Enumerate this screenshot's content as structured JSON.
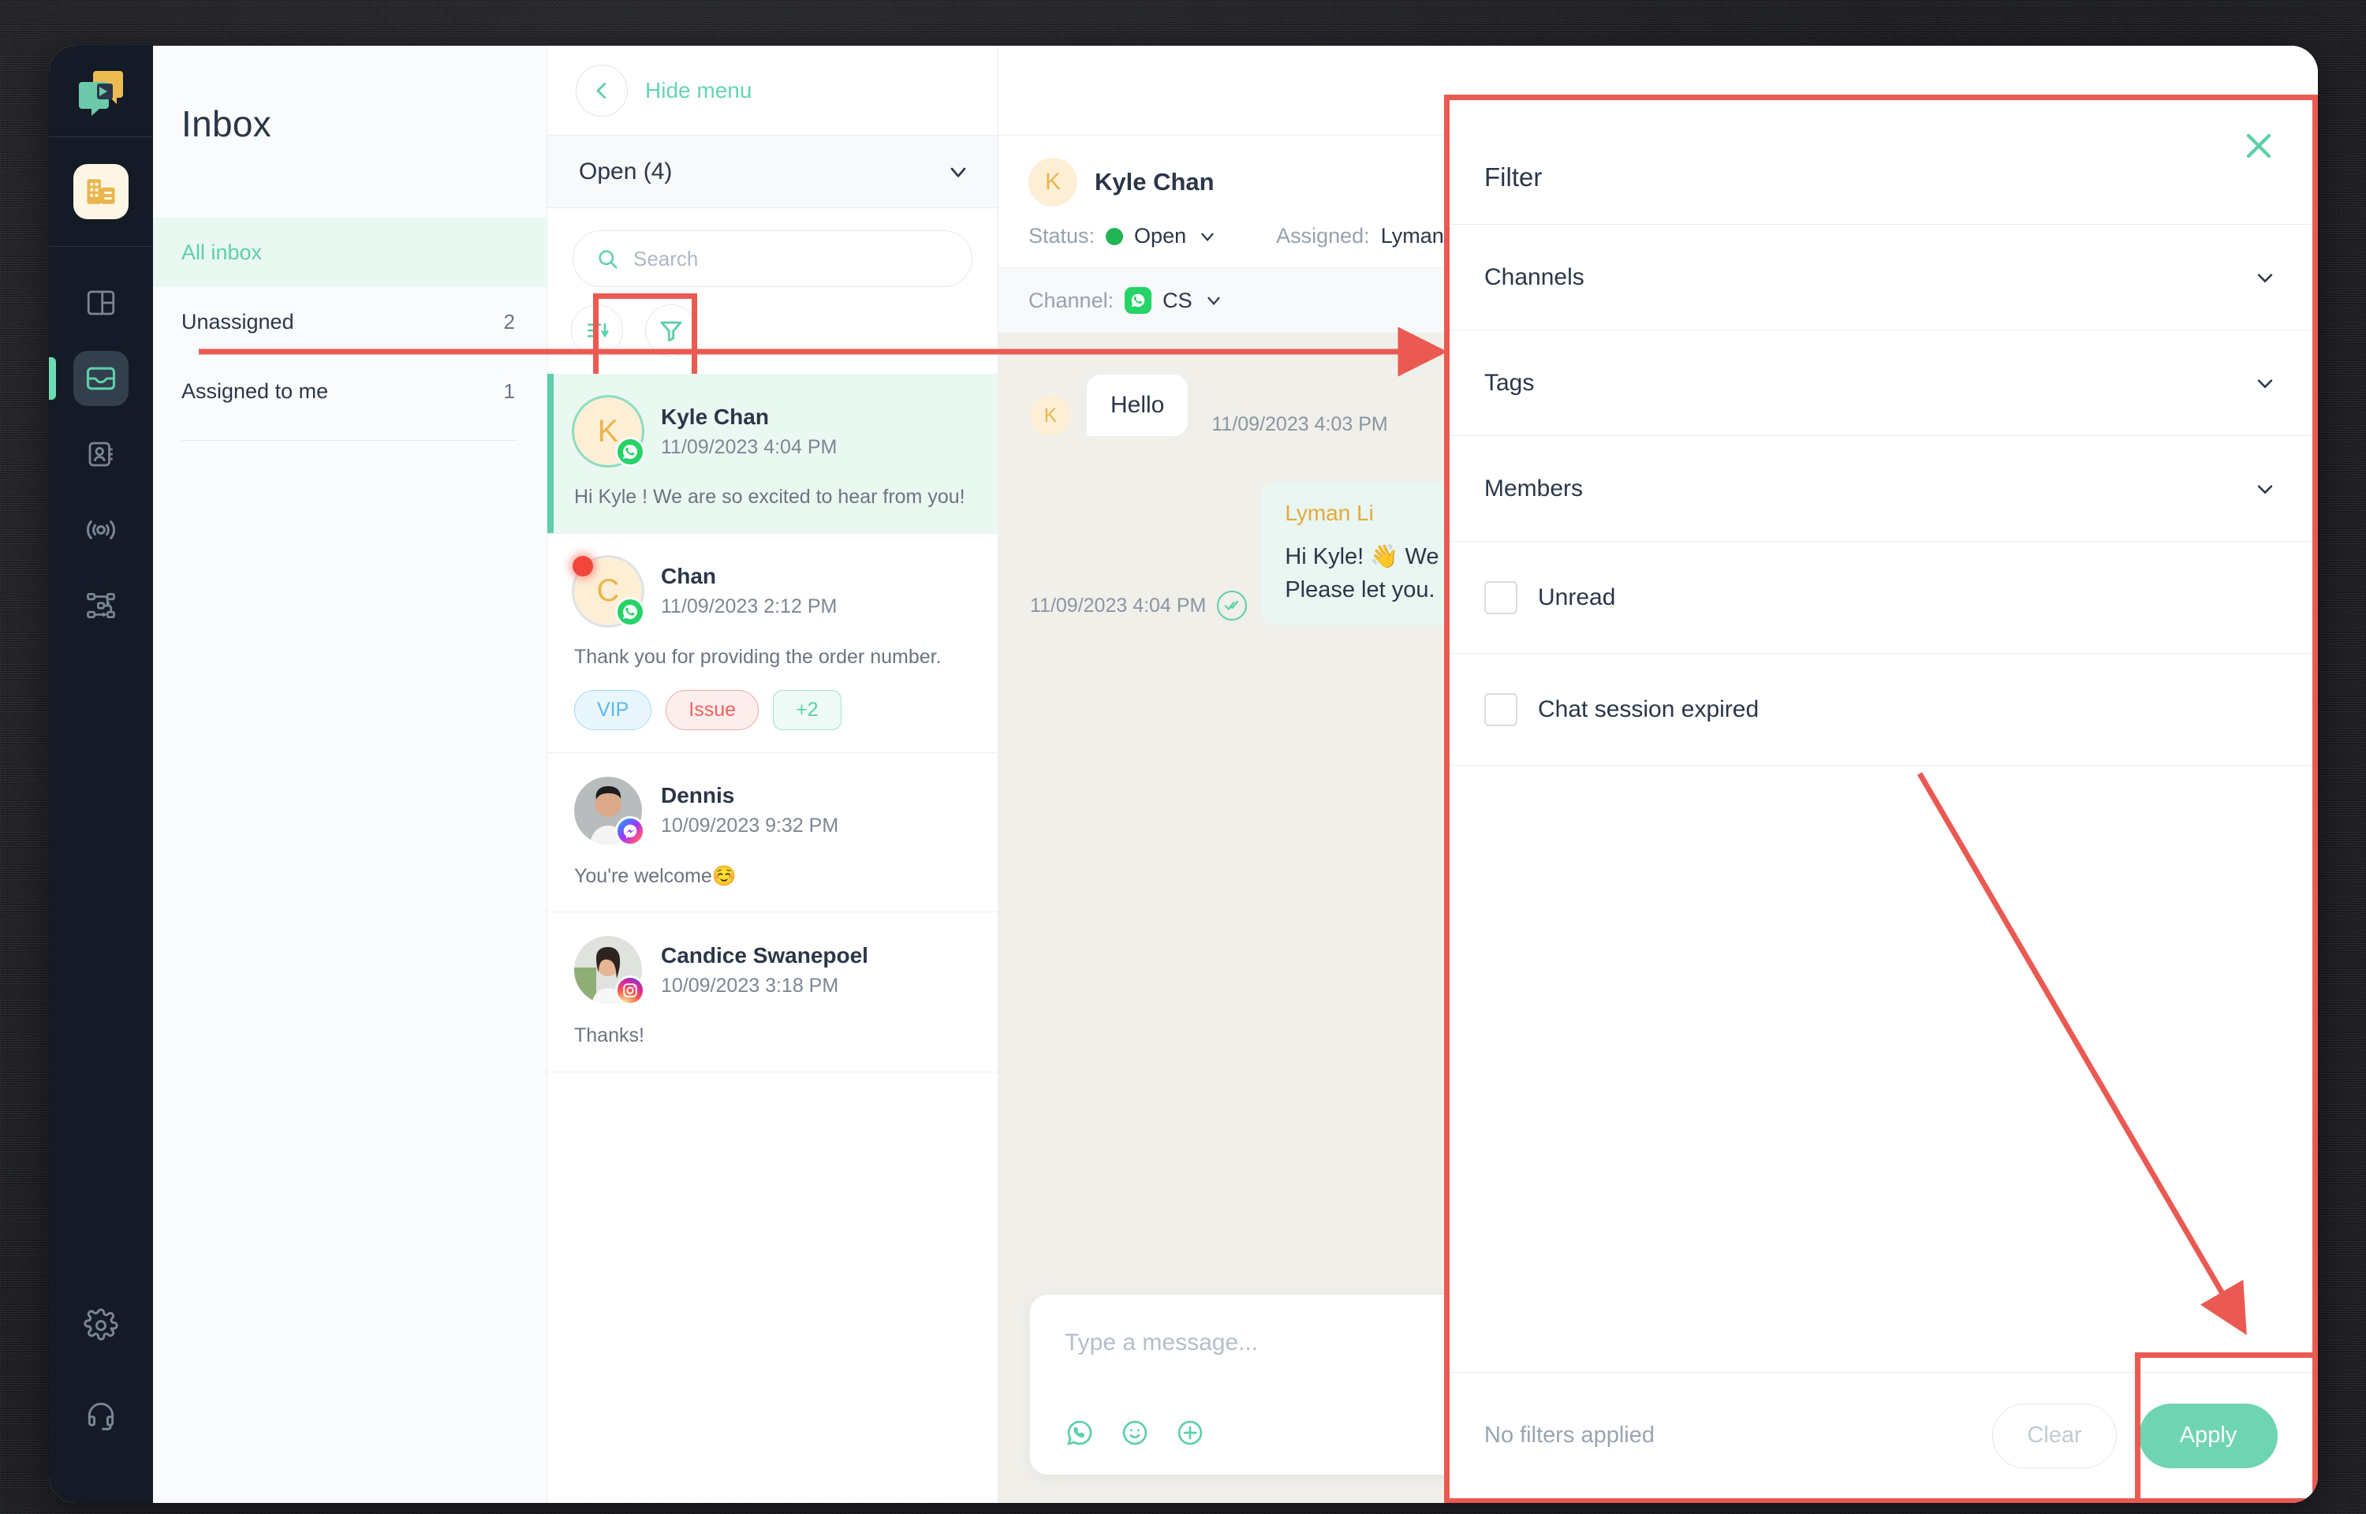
{
  "app": {
    "rail": {
      "logo_icon": "sleekflow-logo-icon",
      "company_icon": "company-building-icon",
      "items": [
        {
          "icon": "dashboard-grid-icon",
          "name": "dashboard",
          "active": false
        },
        {
          "icon": "inbox-tray-icon",
          "name": "inbox",
          "active": true
        },
        {
          "icon": "contacts-book-icon",
          "name": "contacts",
          "active": false
        },
        {
          "icon": "broadcast-icon",
          "name": "broadcast",
          "active": false
        },
        {
          "icon": "automation-flow-icon",
          "name": "automation",
          "active": false
        }
      ],
      "bottom_items": [
        {
          "icon": "gear-icon",
          "name": "settings"
        },
        {
          "icon": "headset-icon",
          "name": "support"
        }
      ]
    },
    "inbox_nav": {
      "title": "Inbox",
      "items": [
        {
          "label": "All inbox",
          "count": "",
          "selected": true
        },
        {
          "label": "Unassigned",
          "count": "2",
          "selected": false
        },
        {
          "label": "Assigned to me",
          "count": "1",
          "selected": false
        }
      ]
    },
    "conv_panel": {
      "hide_menu_label": "Hide menu",
      "back_icon": "chevron-left-icon",
      "status_dropdown_label": "Open (4)",
      "status_dropdown_icon": "chevron-down-icon",
      "search": {
        "placeholder": "Search",
        "icon": "search-icon",
        "value": ""
      },
      "sort_icon": "sort-descending-icon",
      "filter_icon": "filter-funnel-icon",
      "conversations": [
        {
          "name": "Kyle Chan",
          "time": "11/09/2023 4:04 PM",
          "snippet": "Hi Kyle ! We are so excited to hear from you!",
          "initial": "K",
          "channel": "whatsapp",
          "selected": true,
          "unread": false,
          "tags": []
        },
        {
          "name": "Chan",
          "time": "11/09/2023 2:12 PM",
          "snippet": "Thank you for providing the order number.",
          "initial": "C",
          "channel": "whatsapp",
          "selected": false,
          "unread": true,
          "tags": [
            {
              "label": "VIP",
              "style": "vip"
            },
            {
              "label": "Issue",
              "style": "issue"
            },
            {
              "label": "+2",
              "style": "more"
            }
          ]
        },
        {
          "name": "Dennis",
          "time": "10/09/2023 9:32 PM",
          "snippet": "You're welcome☺️",
          "initial": "",
          "channel": "messenger",
          "selected": false,
          "unread": false,
          "tags": []
        },
        {
          "name": "Candice Swanepoel",
          "time": "10/09/2023 3:18 PM",
          "snippet": "Thanks!",
          "initial": "",
          "channel": "instagram",
          "selected": false,
          "unread": false,
          "tags": []
        }
      ]
    },
    "chat": {
      "contact_name": "Kyle Chan",
      "contact_initial": "K",
      "status_label": "Status:",
      "status_value": "Open",
      "status_chevron_icon": "chevron-down-icon",
      "assigned_label": "Assigned:",
      "assigned_value": "Lyman",
      "channel_label": "Channel:",
      "channel_value": "CS",
      "channel_icon": "whatsapp-icon",
      "channel_chevron_icon": "chevron-down-icon",
      "messages": [
        {
          "direction": "in",
          "avatar_initial": "K",
          "text": "Hello",
          "time": "11/09/2023 4:03 PM"
        },
        {
          "direction": "out",
          "sender": "Lyman Li",
          "text": "Hi Kyle! 👋 We you! Please let you.",
          "time": "11/09/2023 4:04 PM",
          "status_icon": "double-check-icon"
        }
      ],
      "composer": {
        "placeholder": "Type a message...",
        "icons": [
          "whatsapp-icon",
          "emoji-icon",
          "plus-circle-icon"
        ]
      }
    },
    "filter_panel": {
      "title": "Filter",
      "close_icon": "close-icon",
      "sections": [
        {
          "label": "Channels",
          "icon": "chevron-down-icon"
        },
        {
          "label": "Tags",
          "icon": "chevron-down-icon"
        },
        {
          "label": "Members",
          "icon": "chevron-down-icon"
        }
      ],
      "checkboxes": [
        {
          "label": "Unread",
          "checked": false
        },
        {
          "label": "Chat session expired",
          "checked": false
        }
      ],
      "footer": {
        "status_text": "No filters applied",
        "clear_label": "Clear",
        "apply_label": "Apply"
      }
    },
    "annotations": {
      "accent_color": "#ea5a52",
      "highlight_filter_button": true,
      "highlight_apply_button": true,
      "arrow_filter_to_panel": true,
      "arrow_panel_to_apply": true
    },
    "colors": {
      "brand_green": "#5ccfab",
      "brand_yellow": "#eab54d",
      "dark_navy": "#141b26",
      "annotation_red": "#ea5a52",
      "status_open_green": "#22b455"
    }
  }
}
